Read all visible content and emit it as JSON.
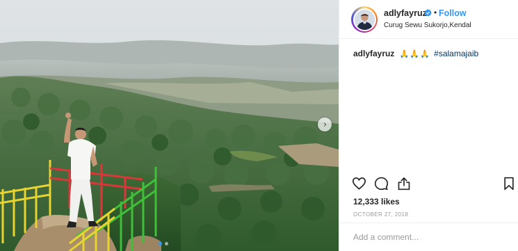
{
  "post": {
    "username": "adlyfayruz",
    "verified": true,
    "separator": "•",
    "follow_label": "Follow",
    "location": "Curug Sewu Sukorjo,Kendal",
    "caption": {
      "username": "adlyfayruz",
      "emoji": "🙏🙏🙏",
      "hashtag": "#salamajaib"
    },
    "likes": "12,333 likes",
    "date": "OCTOBER 27, 2018",
    "comment_placeholder": "Add a comment...",
    "carousel": {
      "next_glyph": "›",
      "slides": 2,
      "active_slide": 1
    }
  },
  "icons": [
    "heart-icon",
    "comment-icon",
    "share-icon",
    "bookmark-icon",
    "verified-badge-icon",
    "chevron-right-icon"
  ],
  "colors": {
    "accent": "#3897f0",
    "hashtag": "#003569",
    "muted": "#999999",
    "border": "#efefef"
  }
}
